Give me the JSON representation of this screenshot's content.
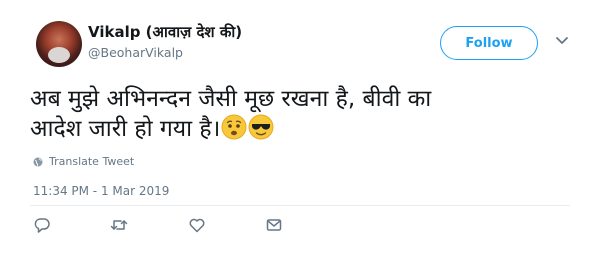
{
  "tweet": {
    "display_name": "Vikalp (आवाज़ देश की)",
    "handle": "@BeoharVikalp",
    "follow_label": "Follow",
    "text_line1": "अब मुझे अभिनन्दन जैसी मूछ रखना है, बीवी का",
    "text_line2": "आदेश जारी हो गया है।",
    "emojis": [
      "worried-face-emoji",
      "sunglasses-face-emoji"
    ],
    "translate_label": "Translate Tweet",
    "timestamp": "11:34 PM - 1 Mar 2019"
  },
  "actions": [
    "reply-icon",
    "retweet-icon",
    "like-icon",
    "message-icon"
  ],
  "colors": {
    "accent": "#1da1f2",
    "text": "#14171a",
    "muted": "#657786",
    "divider": "#e6ecf0",
    "icon": "#657786"
  }
}
